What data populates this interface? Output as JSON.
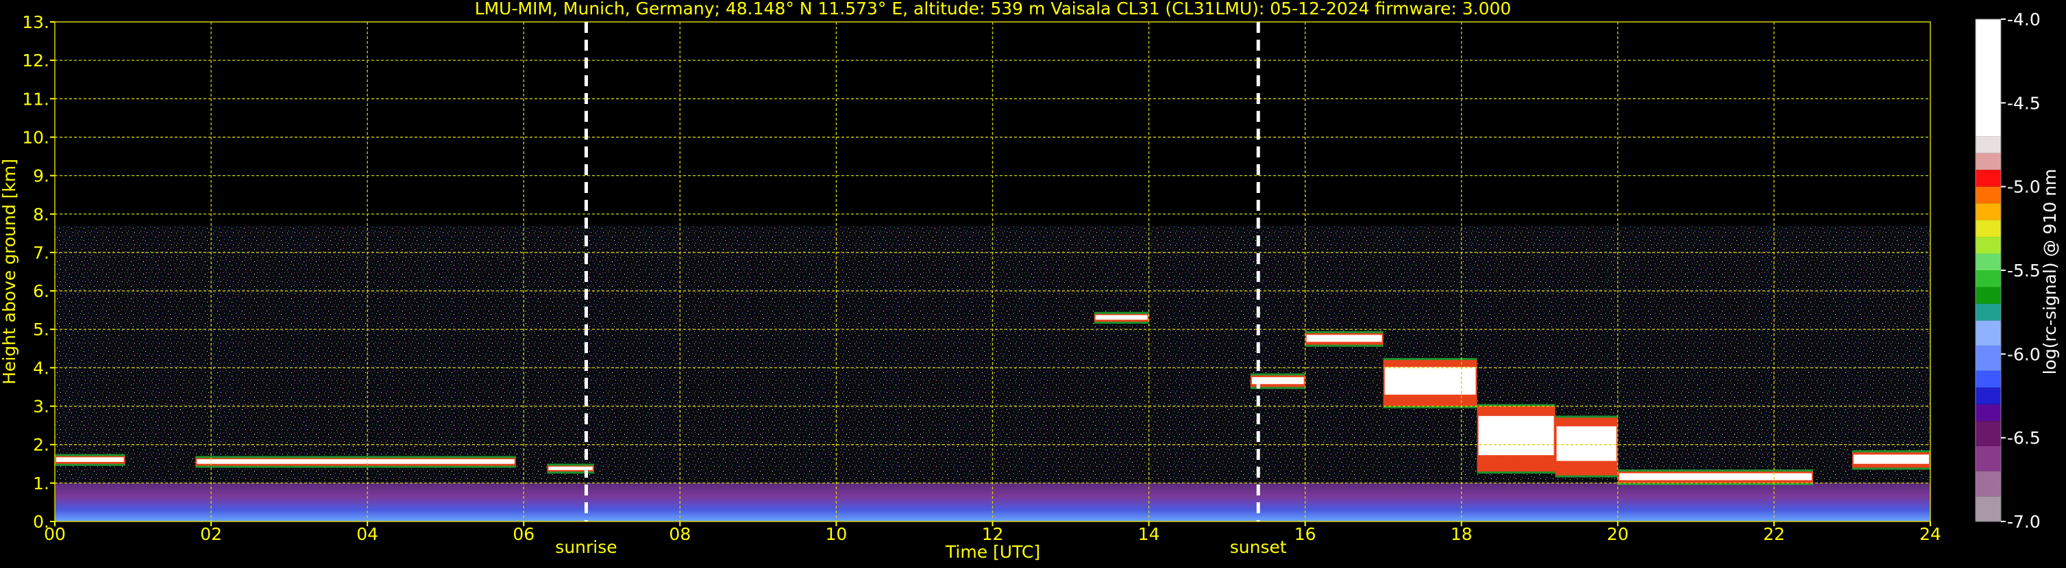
{
  "chart_data": {
    "type": "heatmap",
    "title": "LMU-MIM, Munich, Germany; 48.148° N 11.573° E, altitude: 539 m    Vaisala CL31 (CL31LMU): 05-12-2024    firmware: 3.000",
    "xlabel": "Time [UTC]",
    "ylabel": "Height above ground [km]",
    "x_range": [
      0,
      24
    ],
    "y_range": [
      0,
      13
    ],
    "x_ticks": [
      "00",
      "02",
      "04",
      "06",
      "08",
      "10",
      "12",
      "14",
      "16",
      "18",
      "20",
      "22",
      "24"
    ],
    "y_ticks": [
      "0.",
      "1.",
      "2.",
      "3.",
      "4.",
      "5.",
      "6.",
      "7.",
      "8.",
      "9.",
      "10.",
      "11.",
      "12.",
      "13."
    ],
    "grid": true,
    "colorbar": {
      "label": "log(rc-signal) @ 910 nm",
      "range": [
        -7.0,
        -4.0
      ],
      "ticks": [
        "-4.0",
        "-4.5",
        "-5.0",
        "-5.5",
        "-6.0",
        "-6.5",
        "-7.0"
      ],
      "tick_values": [
        -4.0,
        -4.5,
        -5.0,
        -5.5,
        -6.0,
        -6.5,
        -7.0
      ]
    },
    "markers": [
      {
        "label": "sunrise",
        "time": 6.8
      },
      {
        "label": "sunset",
        "time": 15.4
      }
    ],
    "cloud_layers": [
      {
        "t": [
          0.0,
          0.9
        ],
        "z": [
          1.5,
          1.7
        ]
      },
      {
        "t": [
          1.8,
          5.9
        ],
        "z": [
          1.45,
          1.65
        ]
      },
      {
        "t": [
          6.3,
          6.9
        ],
        "z": [
          1.3,
          1.45
        ]
      },
      {
        "t": [
          13.3,
          14.0
        ],
        "z": [
          5.2,
          5.4
        ]
      },
      {
        "t": [
          15.3,
          16.0
        ],
        "z": [
          3.5,
          3.8
        ]
      },
      {
        "t": [
          16.0,
          17.0
        ],
        "z": [
          4.6,
          4.9
        ]
      },
      {
        "t": [
          17.0,
          18.2
        ],
        "z": [
          3.0,
          4.2
        ]
      },
      {
        "t": [
          18.2,
          19.2
        ],
        "z": [
          1.3,
          3.0
        ]
      },
      {
        "t": [
          19.2,
          20.0
        ],
        "z": [
          1.2,
          2.7
        ]
      },
      {
        "t": [
          20.0,
          22.5
        ],
        "z": [
          1.0,
          1.3
        ]
      },
      {
        "t": [
          23.0,
          24.0
        ],
        "z": [
          1.4,
          1.8
        ]
      }
    ]
  }
}
